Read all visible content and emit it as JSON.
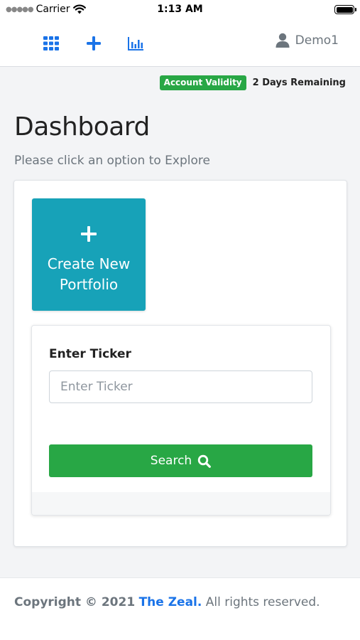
{
  "status_bar": {
    "carrier": "Carrier",
    "time": "1:13 AM"
  },
  "nav": {
    "icons": [
      "grid-icon",
      "plus-icon",
      "bar-chart-icon"
    ],
    "user_name": "Demo1",
    "accent_color": "#1a73e8"
  },
  "account": {
    "badge": "Account Validity",
    "remaining": "2 Days Remaining"
  },
  "page": {
    "title": "Dashboard",
    "subtitle": "Please click an option to Explore"
  },
  "create_tile": {
    "label": "Create New\nPortfolio",
    "color": "#17a2b8"
  },
  "ticker": {
    "label": "Enter Ticker",
    "placeholder": "Enter Ticker",
    "value": "",
    "search_label": "Search",
    "button_color": "#28a745"
  },
  "footer": {
    "prefix": "Copyright © 2021",
    "brand": "The Zeal.",
    "suffix": "All rights reserved."
  }
}
